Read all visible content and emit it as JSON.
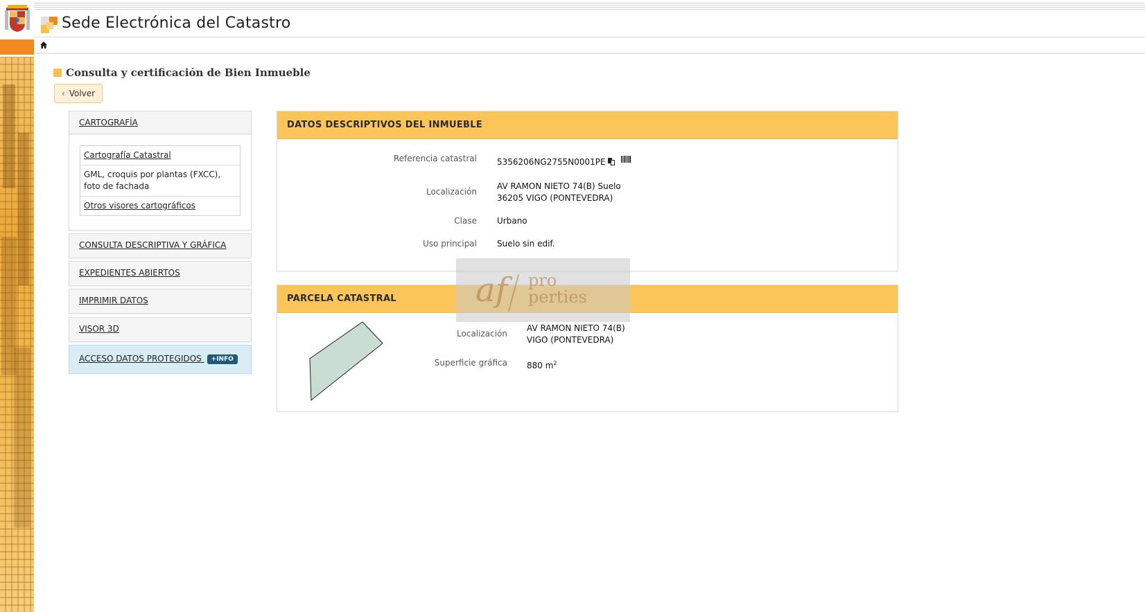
{
  "header": {
    "title": "Sede Electrónica del Catastro"
  },
  "page": {
    "heading": "Consulta y certificación de Bien Inmueble",
    "back_label": "Volver"
  },
  "menu": {
    "cartografia": {
      "label": "CARTOGRAFÍA",
      "items": [
        {
          "label": "Cartografía Catastral"
        },
        {
          "label": "GML, croquis por plantas (FXCC), foto de fachada"
        },
        {
          "label": "Otros visores cartográficos"
        }
      ]
    },
    "consulta": "CONSULTA DESCRIPTIVA Y GRÁFICA",
    "expedientes": "EXPEDIENTES ABIERTOS",
    "imprimir": "IMPRIMIR DATOS",
    "visor3d": "VISOR 3D",
    "acceso": {
      "label": "ACCESO DATOS PROTEGIDOS",
      "badge": "+INFO"
    }
  },
  "datos": {
    "title": "DATOS DESCRIPTIVOS DEL INMUEBLE",
    "referencia_label": "Referencia catastral",
    "referencia_value": "5356206NG2755N0001PE",
    "localizacion_label": "Localización",
    "localizacion_line1": "AV RAMON NIETO 74(B) Suelo",
    "localizacion_line2": "36205 VIGO (PONTEVEDRA)",
    "clase_label": "Clase",
    "clase_value": "Urbano",
    "uso_label": "Uso principal",
    "uso_value": "Suelo sin edif."
  },
  "parcela": {
    "title": "PARCELA CATASTRAL",
    "localizacion_label": "Localización",
    "localizacion_line1": "AV RAMON NIETO 74(B)",
    "localizacion_line2": "VIGO (PONTEVEDRA)",
    "superficie_label": "Superficie gráfica",
    "superficie_value": "880 m",
    "superficie_exp": "2"
  },
  "watermark": {
    "af": "af",
    "pro": "pro",
    "perties": "perties"
  },
  "colors": {
    "accent_orange": "#f08a1f",
    "panel_header": "#fcc55a",
    "parcel_fill": "#c9ddd4",
    "info_badge": "#1e5a7a"
  }
}
